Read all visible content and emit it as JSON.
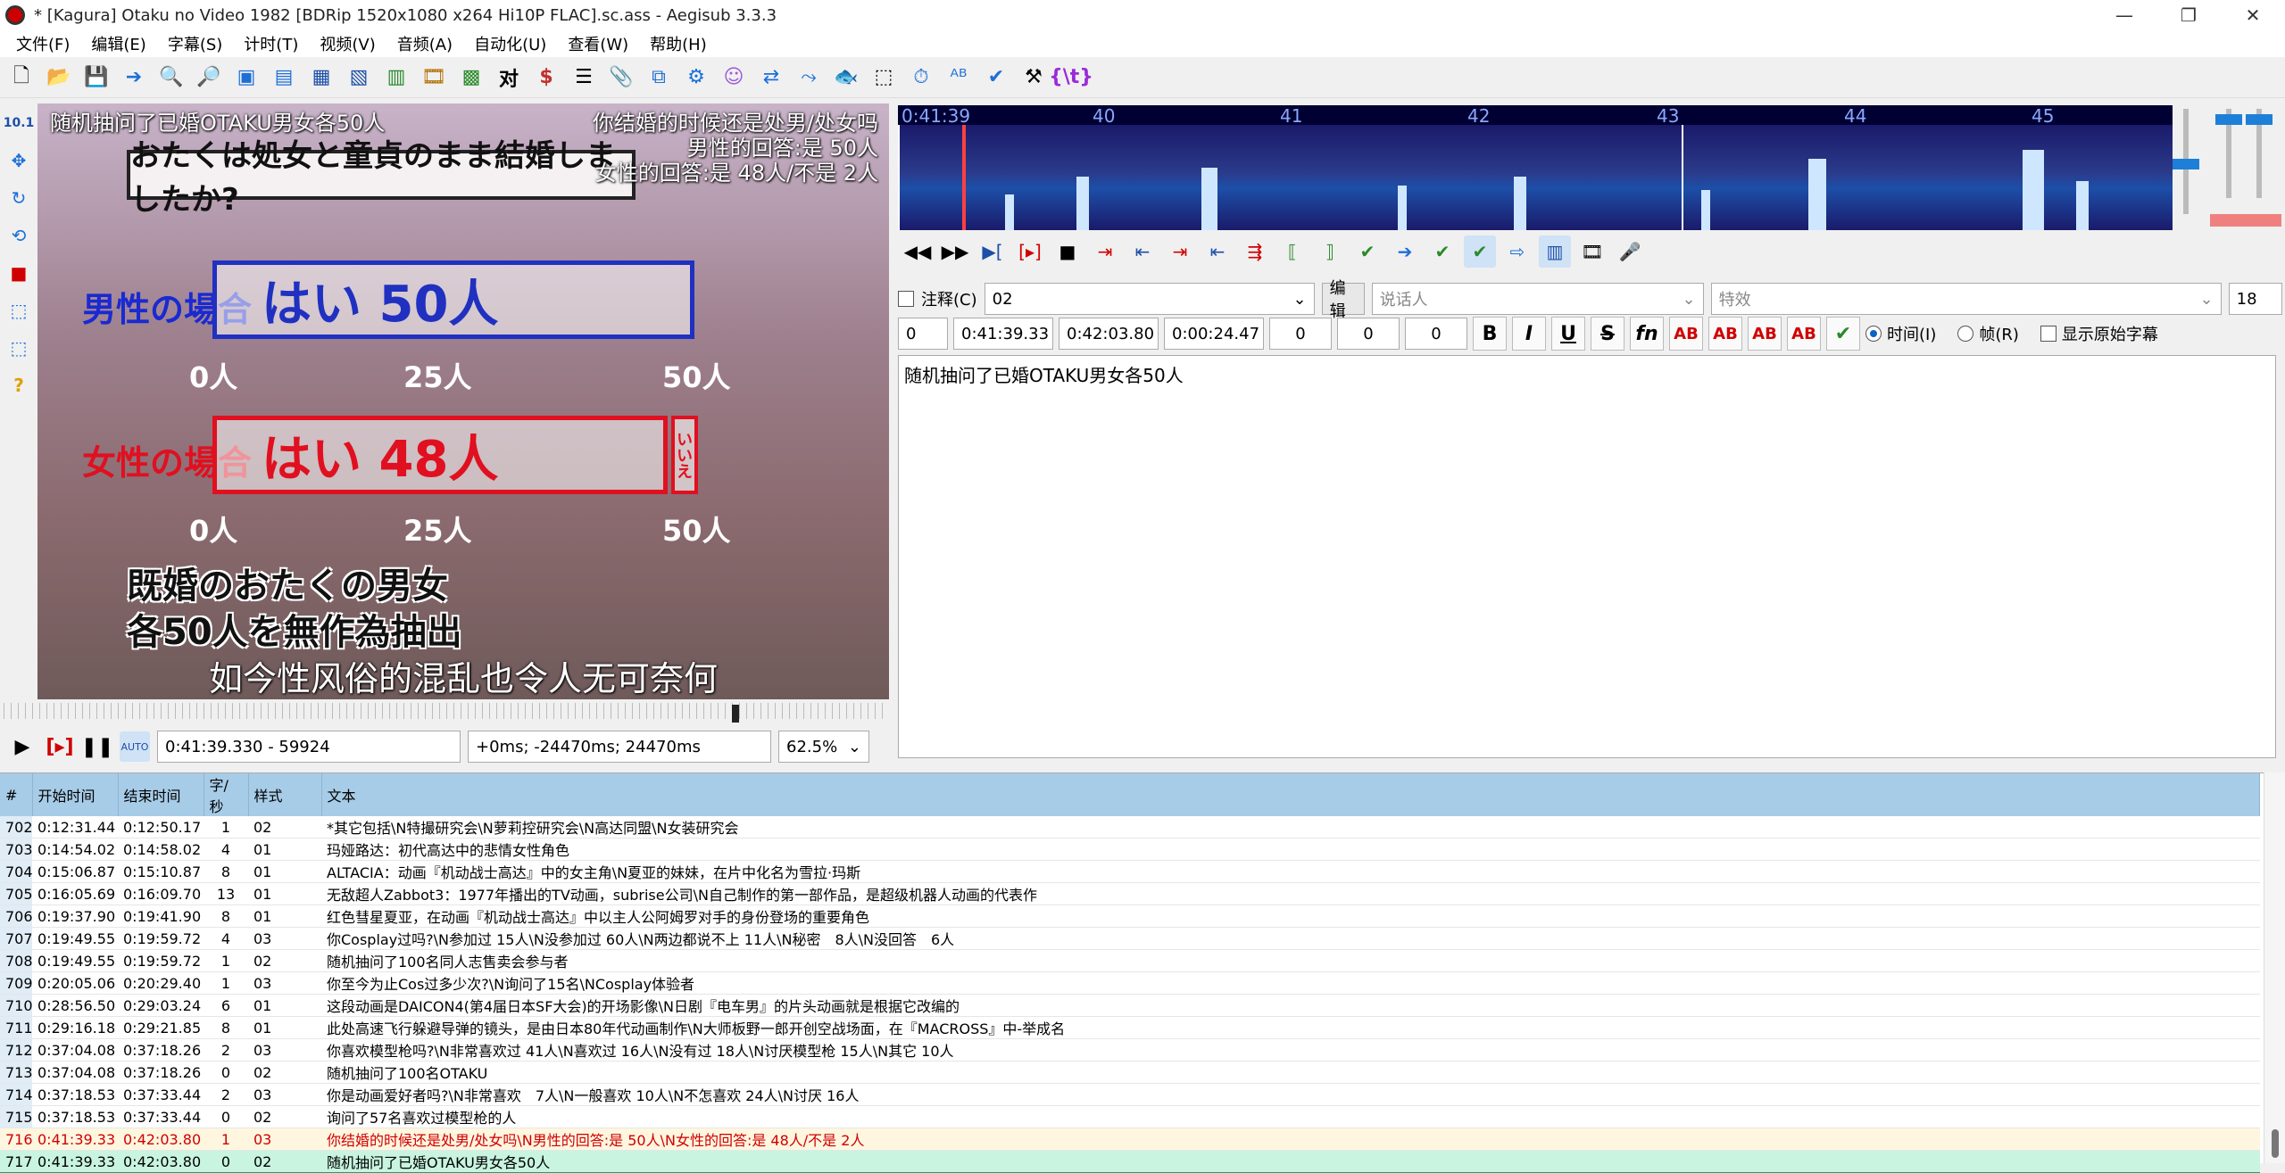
{
  "window": {
    "title": "* [Kagura] Otaku no Video 1982 [BDRip 1520x1080 x264 Hi10P FLAC].sc.ass - Aegisub 3.3.3",
    "minimize": "—",
    "maximize": "❐",
    "close": "✕"
  },
  "menu": [
    "文件(F)",
    "编辑(E)",
    "字幕(S)",
    "计时(T)",
    "视频(V)",
    "音频(A)",
    "自动化(U)",
    "查看(W)",
    "帮助(H)"
  ],
  "video": {
    "sign_text": "おたくは処女と童貞のまま結婚しましたか?",
    "male_label": "男性の場合",
    "female_label": "女性の場合",
    "male_bar_text": "はい 50人",
    "female_bar_text": "はい 48人",
    "female_no_text": "いいえ",
    "ticks": [
      "0人",
      "25人",
      "50人"
    ],
    "caption_line1": "既婚のおたくの男女",
    "caption_line2": "各50人を無作為抽出",
    "sub_top_left": "随机抽问了已婚OTAKU男女各50人",
    "sub_top_right1": "你结婚的时候还是处男/处女吗",
    "sub_top_right2": "男性的回答:是 50人",
    "sub_top_right3": "女性的回答:是 48人/不是 2人",
    "sub_bottom": "如今性风俗的混乱也令人无可奈何"
  },
  "video_controls": {
    "time": "0:41:39.330 - 59924",
    "offset": "+0ms; -24470ms; 24470ms",
    "zoom": "62.5%"
  },
  "audio": {
    "ruler_start": "0:41:39",
    "ruler_marks": [
      "40",
      "41",
      "42",
      "43",
      "44",
      "45"
    ]
  },
  "edit": {
    "comment_label": "注释(C)",
    "style": "02",
    "edit_button": "编辑",
    "actor_placeholder": "说话人",
    "effect_placeholder": "特效",
    "layer_num": "18",
    "layer": "0",
    "start": "0:41:39.33",
    "end": "0:42:03.80",
    "duration": "0:00:24.47",
    "margin_l": "0",
    "margin_r": "0",
    "margin_v": "0",
    "time_radio": "时间(I)",
    "frame_radio": "帧(R)",
    "show_original": "显示原始字幕",
    "text": "随机抽问了已婚OTAKU男女各50人"
  },
  "grid": {
    "headers": [
      "#",
      "开始时间",
      "结束时间",
      "字/秒",
      "样式",
      "文本"
    ],
    "rows": [
      [
        "702",
        "0:12:31.44",
        "0:12:50.17",
        "1",
        "02",
        "*其它包括\\N特撮研究会\\N萝莉控研究会\\N高达同盟\\N女装研究会"
      ],
      [
        "703",
        "0:14:54.02",
        "0:14:58.02",
        "4",
        "01",
        "玛娅路达：初代高达中的悲情女性角色"
      ],
      [
        "704",
        "0:15:06.87",
        "0:15:10.87",
        "8",
        "01",
        "ALTACIA：动画『机动战士高达』中的女主角\\N夏亚的妹妹，在片中化名为雪拉·玛斯"
      ],
      [
        "705",
        "0:16:05.69",
        "0:16:09.70",
        "13",
        "01",
        "无敌超人Zabbot3：1977年播出的TV动画，subrise公司\\N自己制作的第一部作品，是超级机器人动画的代表作"
      ],
      [
        "706",
        "0:19:37.90",
        "0:19:41.90",
        "8",
        "01",
        "红色彗星夏亚，在动画『机动战士高达』中以主人公阿姆罗对手的身份登场的重要角色"
      ],
      [
        "707",
        "0:19:49.55",
        "0:19:59.72",
        "4",
        "03",
        "你Cosplay过吗?\\N参加过 15人\\N没参加过 60人\\N两边都说不上 11人\\N秘密　8人\\N没回答　6人"
      ],
      [
        "708",
        "0:19:49.55",
        "0:19:59.72",
        "1",
        "02",
        "随机抽问了100名同人志售卖会参与者"
      ],
      [
        "709",
        "0:20:05.06",
        "0:20:29.40",
        "1",
        "03",
        "你至今为止Cos过多少次?\\N询问了15名\\NCosplay体验者"
      ],
      [
        "710",
        "0:28:56.50",
        "0:29:03.24",
        "6",
        "01",
        "这段动画是DAICON4(第4届日本SF大会)的开场影像\\N日剧『电车男』的片头动画就是根据它改编的"
      ],
      [
        "711",
        "0:29:16.18",
        "0:29:21.85",
        "8",
        "01",
        "此处高速飞行躲避导弹的镜头，是由日本80年代动画制作\\N大师板野一郎开创空战场面，在『MACROSS』中-举成名"
      ],
      [
        "712",
        "0:37:04.08",
        "0:37:18.26",
        "2",
        "03",
        "你喜欢模型枪吗?\\N非常喜欢过 41人\\N喜欢过 16人\\N没有过 18人\\N讨厌模型枪 15人\\N其它 10人"
      ],
      [
        "713",
        "0:37:04.08",
        "0:37:18.26",
        "0",
        "02",
        "随机抽问了100名OTAKU"
      ],
      [
        "714",
        "0:37:18.53",
        "0:37:33.44",
        "2",
        "03",
        "你是动画爱好者吗?\\N非常喜欢　7人\\N一般喜欢 10人\\N不怎喜欢 24人\\N讨厌 16人"
      ],
      [
        "715",
        "0:37:18.53",
        "0:37:33.44",
        "0",
        "02",
        "询问了57名喜欢过模型枪的人"
      ],
      [
        "716",
        "0:41:39.33",
        "0:42:03.80",
        "1",
        "03",
        "你结婚的时候还是处男/处女吗\\N男性的回答:是 50人\\N女性的回答:是 48人/不是 2人"
      ],
      [
        "717",
        "0:41:39.33",
        "0:42:03.80",
        "0",
        "02",
        "随机抽问了已婚OTAKU男女各50人"
      ]
    ]
  }
}
